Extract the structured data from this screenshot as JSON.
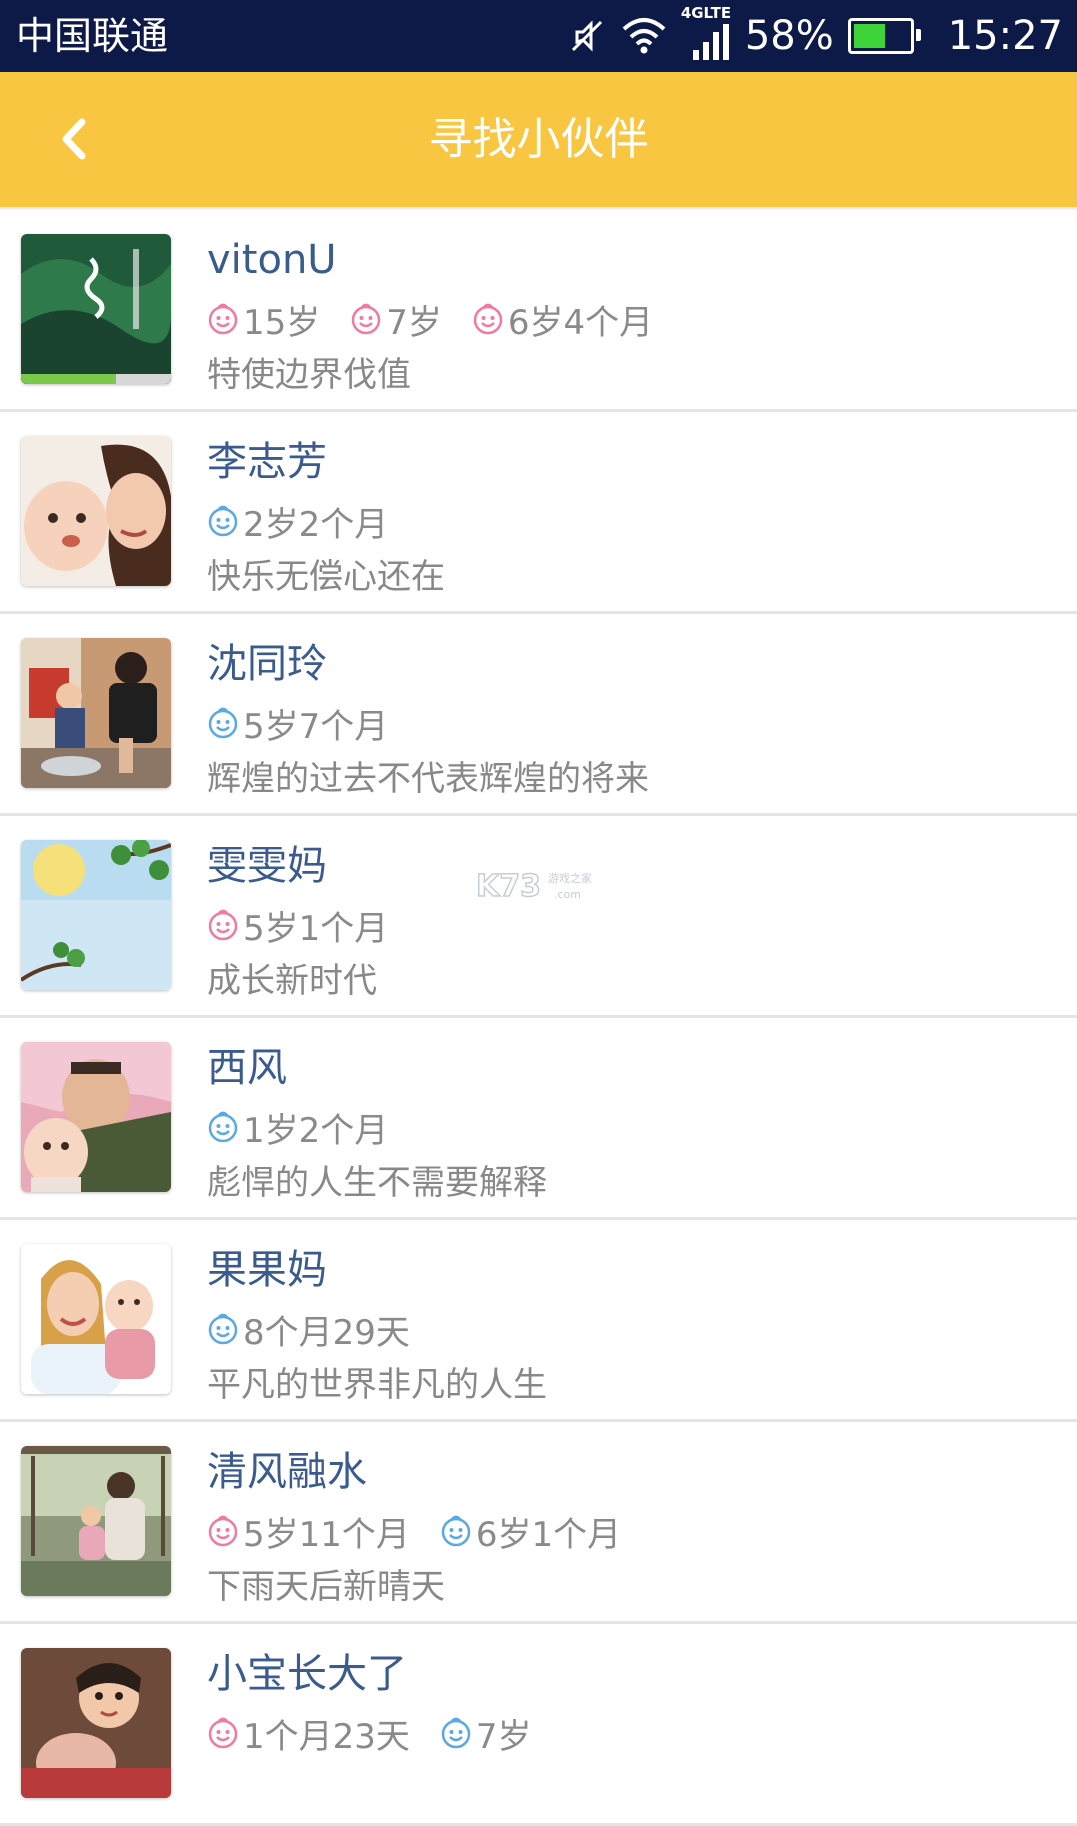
{
  "status_bar": {
    "carrier": "中国联通",
    "network_type": "4GLTE",
    "battery_percent": "58%",
    "battery_level": 0.58,
    "time": "15:27",
    "icons": [
      "mute-icon",
      "wifi-icon",
      "signal-icon",
      "battery-icon"
    ]
  },
  "header": {
    "title": "寻找小伙伴",
    "back_icon": "chevron-left-icon",
    "background_color": "#f8c641"
  },
  "colors": {
    "name_text": "#3b5b8f",
    "girl_icon": "#f07aa6",
    "boy_icon": "#5aa8e6"
  },
  "users": [
    {
      "name": "vitonU",
      "children": [
        {
          "gender": "girl",
          "age": "15岁"
        },
        {
          "gender": "girl",
          "age": "7岁"
        },
        {
          "gender": "girl",
          "age": "6岁4个月"
        }
      ],
      "motto": "特使边界伐值"
    },
    {
      "name": "李志芳",
      "children": [
        {
          "gender": "boy",
          "age": "2岁2个月"
        }
      ],
      "motto": "快乐无偿心还在"
    },
    {
      "name": "沈同玲",
      "children": [
        {
          "gender": "boy",
          "age": "5岁7个月"
        }
      ],
      "motto": "辉煌的过去不代表辉煌的将来"
    },
    {
      "name": "雯雯妈",
      "children": [
        {
          "gender": "girl",
          "age": "5岁1个月"
        }
      ],
      "motto": "成长新时代"
    },
    {
      "name": "西风",
      "children": [
        {
          "gender": "boy",
          "age": "1岁2个月"
        }
      ],
      "motto": "彪悍的人生不需要解释"
    },
    {
      "name": "果果妈",
      "children": [
        {
          "gender": "boy",
          "age": "8个月29天"
        }
      ],
      "motto": "平凡的世界非凡的人生"
    },
    {
      "name": "清风融水",
      "children": [
        {
          "gender": "girl",
          "age": "5岁11个月"
        },
        {
          "gender": "boy",
          "age": "6岁1个月"
        }
      ],
      "motto": "下雨天后新晴天"
    },
    {
      "name": "小宝长大了",
      "children": [
        {
          "gender": "girl",
          "age": "1个月23天"
        },
        {
          "gender": "boy",
          "age": "7岁"
        }
      ],
      "motto": ""
    }
  ]
}
